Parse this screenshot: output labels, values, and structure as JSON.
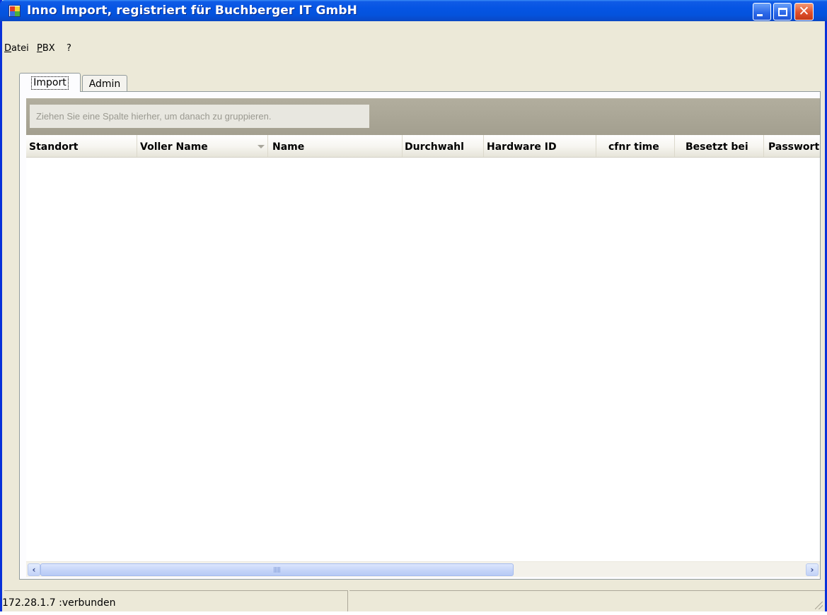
{
  "window": {
    "title": "Inno Import, registriert für Buchberger IT GmbH",
    "icon": "app-icon",
    "controls": {
      "minimize": "minimize-icon",
      "maximize": "maximize-icon",
      "close": "close-icon"
    }
  },
  "menu": {
    "items": [
      {
        "label": "Datei",
        "mnemonic": "D",
        "rest": "atei"
      },
      {
        "label": "PBX",
        "mnemonic": "P",
        "rest": "BX"
      },
      {
        "label": "?"
      }
    ]
  },
  "tabs": [
    {
      "label": "Import",
      "selected": true
    },
    {
      "label": "Admin",
      "selected": false
    }
  ],
  "grid": {
    "group_hint": "Ziehen Sie eine Spalte hierher, um danach zu gruppieren.",
    "columns": [
      "Standort",
      "Voller Name",
      "Name",
      "Durchwahl",
      "Hardware ID",
      "cfnr time",
      "Besetzt bei",
      "Passwort"
    ],
    "sorted_column": "Voller Name",
    "sort_direction": "descending",
    "rows": []
  },
  "scrollbar": {
    "left_icon": "scroll-left-arrow-icon",
    "right_icon": "scroll-right-arrow-icon"
  },
  "statusbar": {
    "connection": "172.28.1.7 :verbunden"
  },
  "colors": {
    "titlebar": "#0554e3",
    "window_face": "#ece9d8",
    "group_panel": "#a39f8f"
  }
}
